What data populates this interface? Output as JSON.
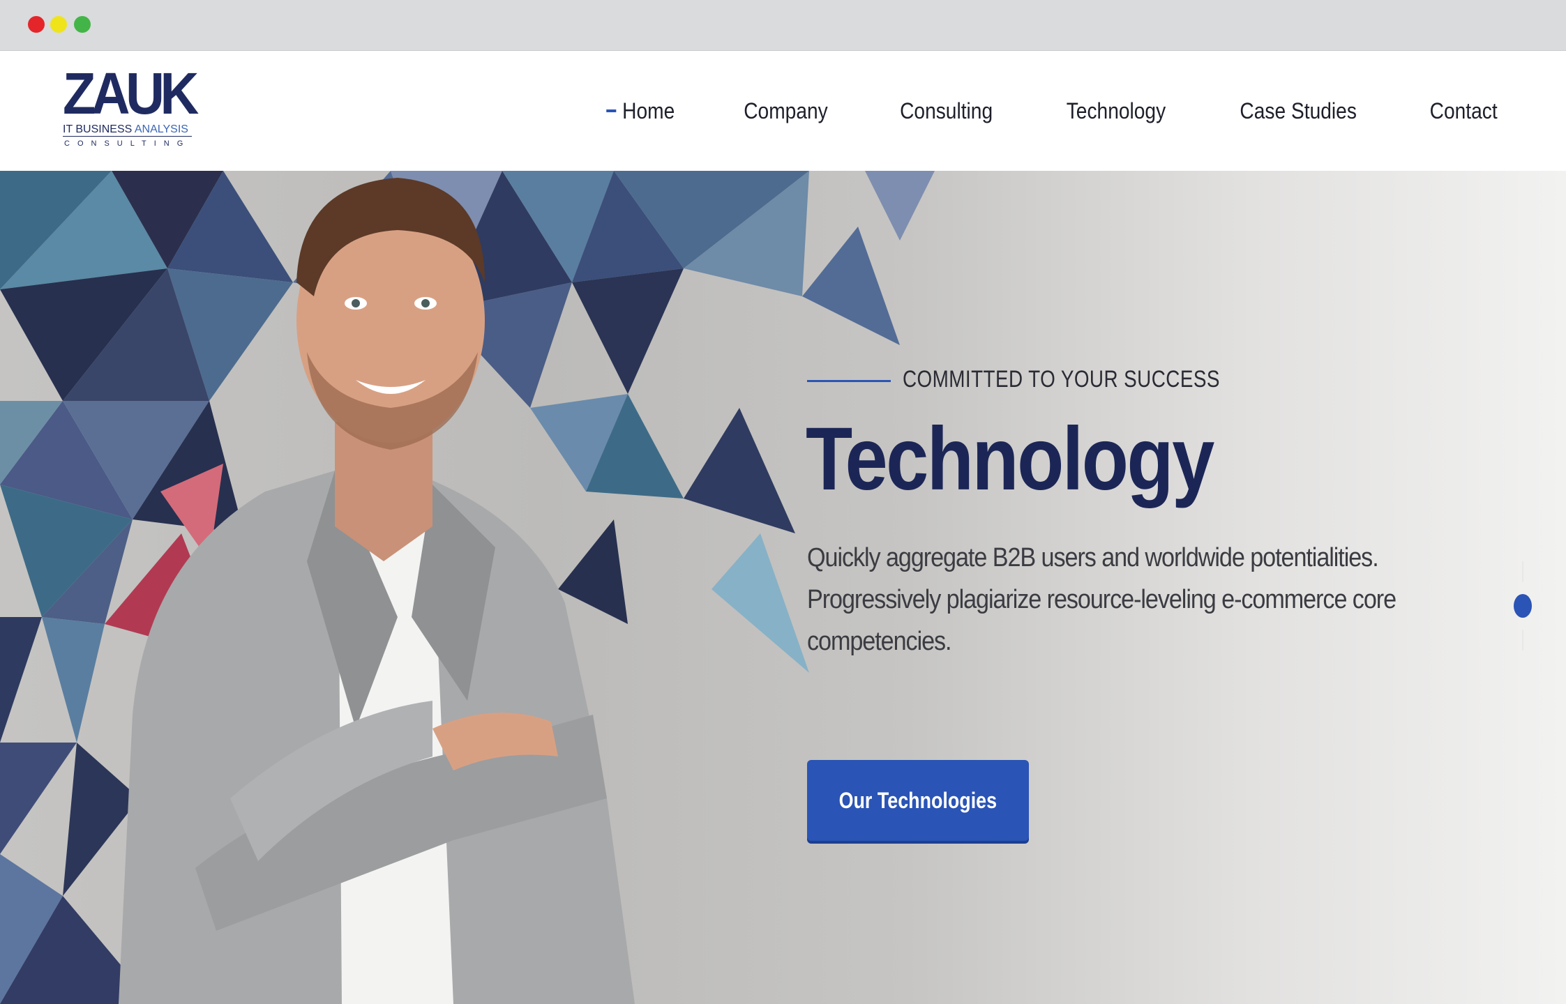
{
  "window": {
    "controls": [
      "close",
      "minimize",
      "maximize"
    ]
  },
  "logo": {
    "mark": "ZAUK",
    "line1_part1": "IT BUSINESS ",
    "line1_part2": "ANALYSIS",
    "line2": "CONSULTING"
  },
  "nav": {
    "items": [
      {
        "label": "Home",
        "active": true
      },
      {
        "label": "Company",
        "active": false
      },
      {
        "label": "Consulting",
        "active": false
      },
      {
        "label": "Technology",
        "active": false
      },
      {
        "label": "Case Studies",
        "active": false
      },
      {
        "label": "Contact",
        "active": false
      }
    ]
  },
  "hero": {
    "tagline": "COMMITTED TO YOUR SUCCESS",
    "title": "Technology",
    "description": "Quickly aggregate B2B users and worldwide potentialities. Progressively plagiarize resource-leveling e-commerce core competencies.",
    "button_label": "Our Technologies",
    "slider": {
      "active_index": 0
    }
  },
  "colors": {
    "accent": "#2a54b5",
    "brand_navy": "#1c2656",
    "chrome": "#d9dbdc"
  },
  "icons": {
    "close": "red-circle",
    "minimize": "yellow-circle",
    "maximize": "green-circle"
  }
}
